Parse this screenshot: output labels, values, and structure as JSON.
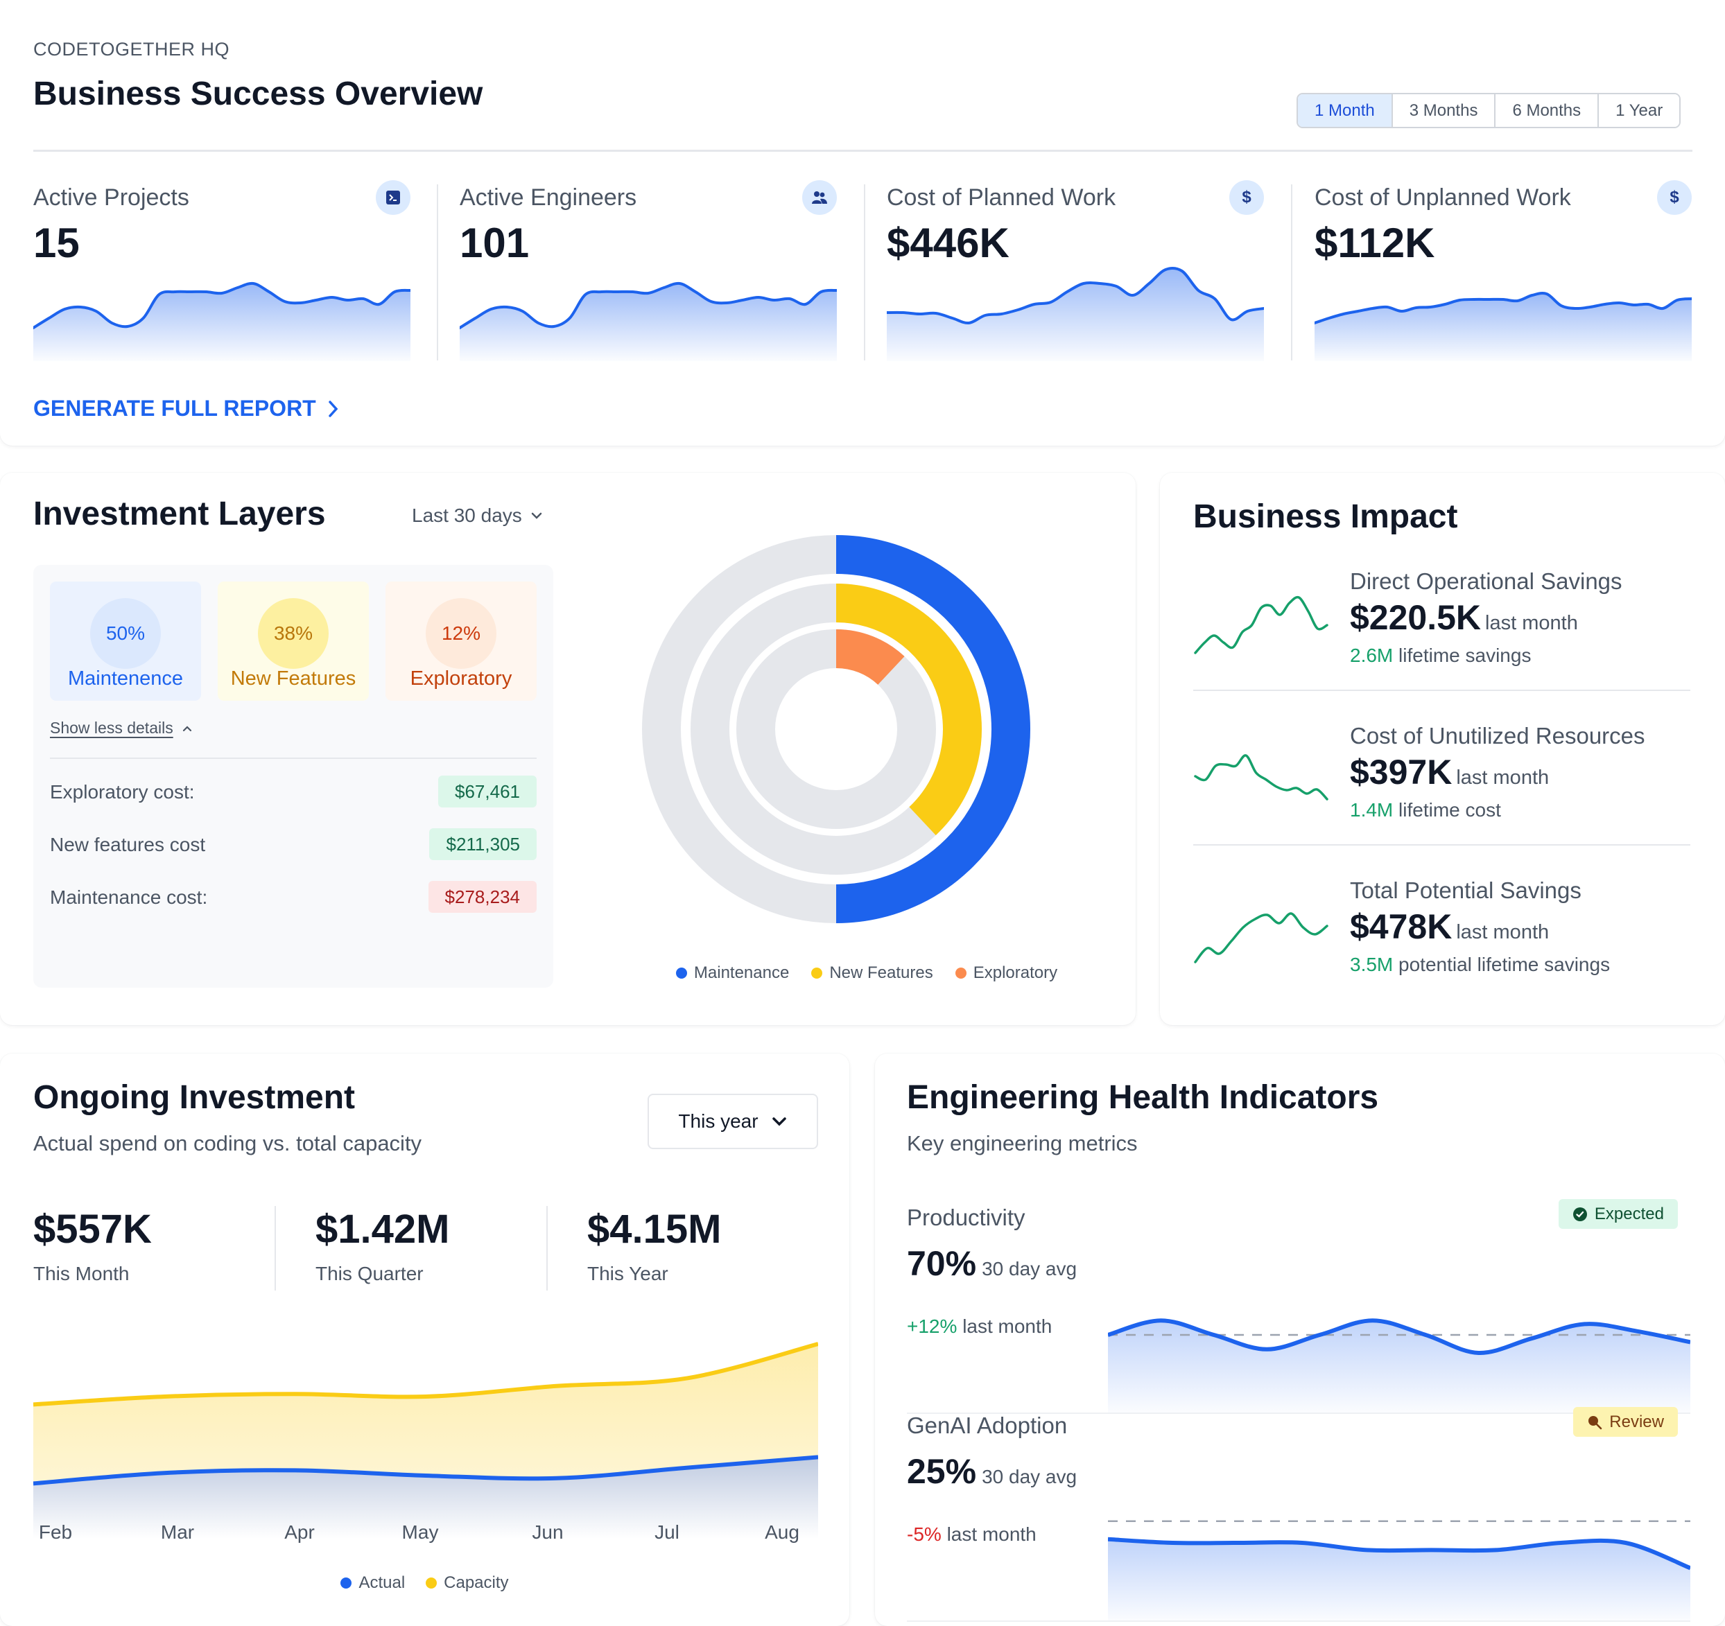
{
  "header": {
    "org": "CODETOGETHER HQ",
    "title": "Business Success Overview",
    "range_tabs": [
      {
        "label": "1 Month",
        "active": true
      },
      {
        "label": "3 Months",
        "active": false
      },
      {
        "label": "6 Months",
        "active": false
      },
      {
        "label": "1 Year",
        "active": false
      }
    ]
  },
  "kpis": [
    {
      "label": "Active Projects",
      "value": "15",
      "icon": "terminal-icon",
      "trend": [
        0.08,
        0.22,
        0.35,
        0.38,
        0.32,
        0.15,
        0.1,
        0.22,
        0.56,
        0.6,
        0.6,
        0.6,
        0.58,
        0.66,
        0.72,
        0.6,
        0.46,
        0.44,
        0.48,
        0.52,
        0.48,
        0.5,
        0.42,
        0.6,
        0.62
      ]
    },
    {
      "label": "Active Engineers",
      "value": "101",
      "icon": "users-icon",
      "trend": [
        0.08,
        0.22,
        0.35,
        0.38,
        0.32,
        0.15,
        0.1,
        0.22,
        0.56,
        0.6,
        0.6,
        0.6,
        0.58,
        0.66,
        0.72,
        0.6,
        0.46,
        0.44,
        0.48,
        0.52,
        0.48,
        0.5,
        0.42,
        0.6,
        0.62
      ]
    },
    {
      "label": "Cost of Planned Work",
      "value": "$446K",
      "icon": "dollar-icon",
      "trend": [
        0.3,
        0.3,
        0.28,
        0.29,
        0.22,
        0.15,
        0.26,
        0.28,
        0.34,
        0.42,
        0.45,
        0.6,
        0.72,
        0.72,
        0.68,
        0.55,
        0.72,
        0.92,
        0.9,
        0.62,
        0.5,
        0.2,
        0.32,
        0.36
      ]
    },
    {
      "label": "Cost of Unplanned Work",
      "value": "$112K",
      "icon": "dollar-icon",
      "trend": [
        0.15,
        0.22,
        0.28,
        0.32,
        0.36,
        0.38,
        0.32,
        0.37,
        0.38,
        0.42,
        0.48,
        0.49,
        0.49,
        0.49,
        0.47,
        0.55,
        0.57,
        0.4,
        0.36,
        0.38,
        0.42,
        0.44,
        0.41,
        0.42,
        0.36,
        0.48,
        0.5
      ]
    }
  ],
  "generate_report": {
    "label": "GENERATE FULL REPORT"
  },
  "investment_layers": {
    "title": "Investment Layers",
    "period": "Last 30 days",
    "layers": [
      {
        "name": "Maintenence",
        "percent": "50%",
        "color": "#1d63ed"
      },
      {
        "name": "New Features",
        "percent": "38%",
        "color": "#facc15"
      },
      {
        "name": "Exploratory",
        "percent": "12%",
        "color": "#fb8b4e"
      }
    ],
    "toggle_details": "Show less details",
    "costs": [
      {
        "label": "Exploratory cost:",
        "value": "$67,461",
        "tone": "good"
      },
      {
        "label": "New features cost",
        "value": "$211,305",
        "tone": "good"
      },
      {
        "label": "Maintenance cost:",
        "value": "$278,234",
        "tone": "bad"
      }
    ],
    "legend": [
      "Maintenance",
      "New Features",
      "Exploratory"
    ]
  },
  "chart_data": [
    {
      "type": "pie",
      "title": "Investment Layers (radial rings)",
      "categories": [
        "Maintenance",
        "New Features",
        "Exploratory"
      ],
      "values": [
        50,
        38,
        12
      ],
      "unit": "%",
      "colors": [
        "#1d63ed",
        "#facc15",
        "#fb8b4e"
      ],
      "legend": "bottom"
    },
    {
      "type": "area",
      "title": "Ongoing Investment",
      "x": [
        "Feb",
        "Mar",
        "Apr",
        "May",
        "Jun",
        "Jul",
        "Aug"
      ],
      "series": [
        {
          "name": "Actual",
          "color": "#1d63ed",
          "values": [
            0.42,
            0.46,
            0.47,
            0.45,
            0.44,
            0.48,
            0.52
          ]
        },
        {
          "name": "Capacity",
          "color": "#facc15",
          "values": [
            0.72,
            0.75,
            0.76,
            0.75,
            0.79,
            0.82,
            0.95
          ]
        }
      ],
      "ylim": [
        0,
        1
      ],
      "legend": "bottom",
      "grid": false
    }
  ],
  "business_impact": {
    "title": "Business Impact",
    "items": [
      {
        "label": "Direct Operational Savings",
        "value": "$220.5K",
        "period": "last month",
        "sub_value": "2.6M",
        "sub_text": "lifetime savings",
        "trend": [
          0.1,
          0.25,
          0.35,
          0.25,
          0.18,
          0.4,
          0.5,
          0.75,
          0.78,
          0.65,
          0.82,
          0.9,
          0.7,
          0.45,
          0.5
        ]
      },
      {
        "label": "Cost of Unutilized Resources",
        "value": "$397K",
        "period": "last month",
        "sub_value": "1.4M",
        "sub_text": "lifetime cost",
        "trend": [
          0.55,
          0.5,
          0.7,
          0.72,
          0.7,
          0.85,
          0.6,
          0.5,
          0.4,
          0.35,
          0.38,
          0.3,
          0.36,
          0.22
        ]
      },
      {
        "label": "Total Potential Savings",
        "value": "$478K",
        "period": "last month",
        "sub_value": "3.5M",
        "sub_text": "potential lifetime savings",
        "trend": [
          0.1,
          0.3,
          0.22,
          0.4,
          0.6,
          0.72,
          0.78,
          0.66,
          0.8,
          0.6,
          0.5,
          0.62
        ]
      }
    ]
  },
  "ongoing_investment": {
    "title": "Ongoing Investment",
    "subtitle": "Actual spend on coding vs. total capacity",
    "period": "This year",
    "stats": [
      {
        "value": "$557K",
        "label": "This Month"
      },
      {
        "value": "$1.42M",
        "label": "This Quarter"
      },
      {
        "value": "$4.15M",
        "label": "This Year"
      }
    ],
    "legend": [
      "Actual",
      "Capacity"
    ]
  },
  "engineering_health": {
    "title": "Engineering Health Indicators",
    "subtitle": "Key engineering metrics",
    "metrics": [
      {
        "name": "Productivity",
        "value": "70%",
        "avg_label": "30 day avg",
        "change": "+12%",
        "change_label": "last month",
        "change_tone": "up",
        "status": "Expected",
        "status_tone": "good",
        "target": 0.7,
        "trend": [
          0.7,
          0.78,
          0.7,
          0.62,
          0.7,
          0.78,
          0.7,
          0.6,
          0.68,
          0.76,
          0.72,
          0.66
        ]
      },
      {
        "name": "GenAI Adoption",
        "value": "25%",
        "avg_label": "30 day avg",
        "change": "-5%",
        "change_label": "last month",
        "change_tone": "down",
        "status": "Review",
        "status_tone": "warn",
        "target": 0.82,
        "trend": [
          0.72,
          0.7,
          0.7,
          0.7,
          0.66,
          0.66,
          0.66,
          0.7,
          0.7,
          0.56
        ]
      }
    ]
  }
}
